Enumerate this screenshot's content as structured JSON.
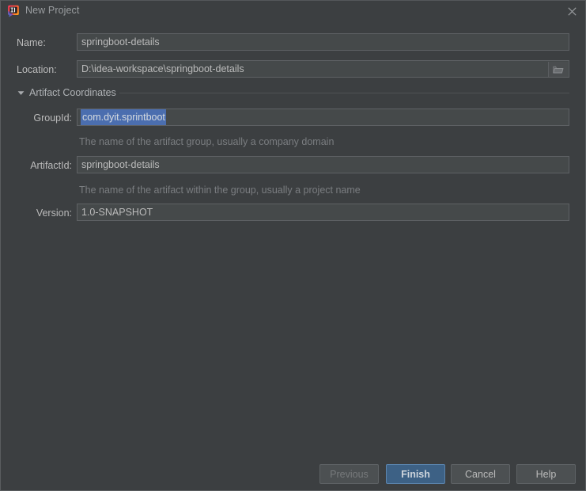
{
  "window": {
    "title": "New Project",
    "app_icon": "intellij-idea-icon",
    "close_icon": "close-icon"
  },
  "form": {
    "name": {
      "label": "Name:",
      "value": "springboot-details"
    },
    "location": {
      "label": "Location:",
      "value": "D:\\idea-workspace\\springboot-details",
      "browse_icon": "folder-icon"
    },
    "section": {
      "title": "Artifact Coordinates",
      "expanded": true,
      "caret_icon": "chevron-down-icon"
    },
    "group_id": {
      "label": "GroupId:",
      "value": "com.dyit.sprintboot",
      "selected": true,
      "hint": "The name of the artifact group, usually a company domain"
    },
    "artifact_id": {
      "label": "ArtifactId:",
      "value": "springboot-details",
      "hint": "The name of the artifact within the group, usually a project name"
    },
    "version": {
      "label": "Version:",
      "value": "1.0-SNAPSHOT"
    }
  },
  "buttons": {
    "previous": "Previous",
    "finish": "Finish",
    "cancel": "Cancel",
    "help": "Help"
  },
  "colors": {
    "dialog_background": "#3c3f41",
    "field_background": "#45494a",
    "field_border": "#5e6164",
    "text_primary": "#bbbbbb",
    "text_muted": "#7a7d80",
    "selection_blue": "#4b6eaf",
    "primary_button": "#3d6185",
    "primary_button_border": "#5b84ad"
  }
}
